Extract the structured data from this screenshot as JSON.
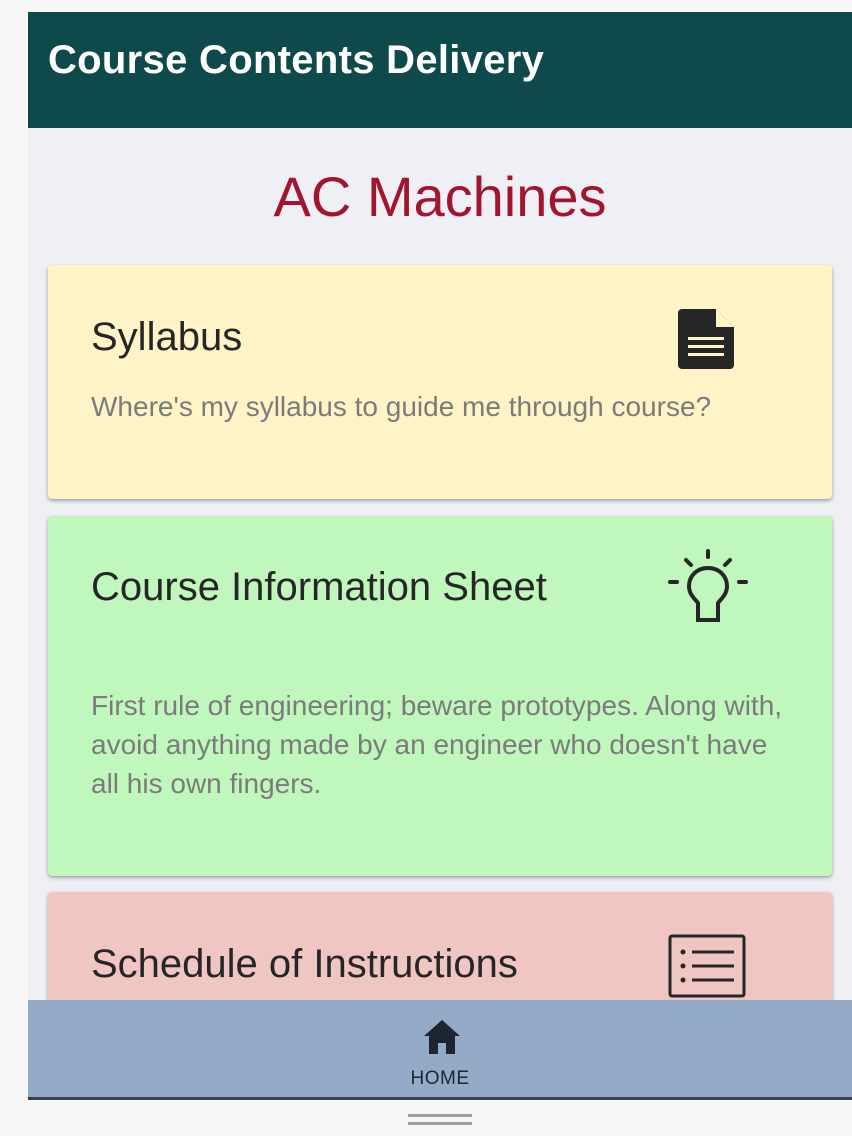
{
  "app_bar": {
    "title": "Course Contents Delivery"
  },
  "page": {
    "title": "AC Machines"
  },
  "cards": [
    {
      "title": "Syllabus",
      "description": "Where's my syllabus to guide me through course?",
      "icon": "document-icon",
      "background": "#fff4c8"
    },
    {
      "title": "Course Information Sheet",
      "description": "First rule of engineering; beware prototypes. Along with, avoid anything made by an engineer who doesn't have all his own fingers.",
      "icon": "lightbulb-icon",
      "background": "#c0f7bd"
    },
    {
      "title": "Schedule of Instructions",
      "description": "",
      "icon": "list-icon",
      "background": "#f0c6c3"
    }
  ],
  "bottom_nav": {
    "home_label": "HOME",
    "home_icon": "home-icon"
  },
  "colors": {
    "app_bar": "#0e4a4b",
    "page_title": "#a3152f",
    "bottom_nav": "#93abc7"
  }
}
